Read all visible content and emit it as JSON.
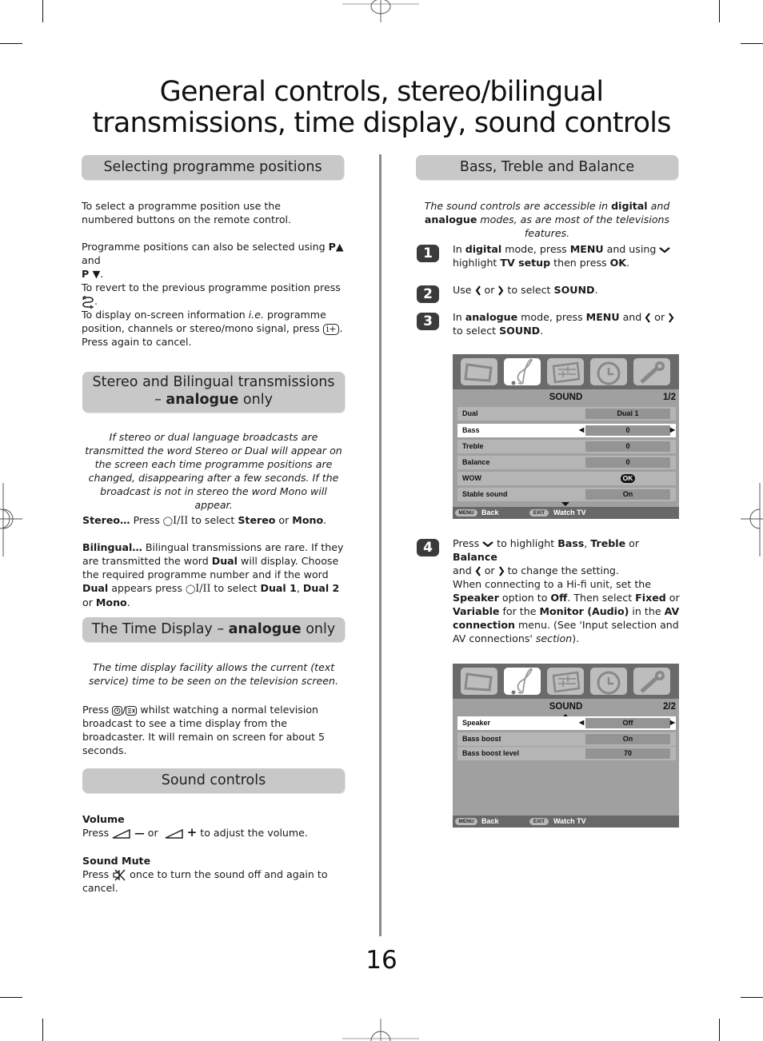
{
  "page": {
    "title_line1": "General controls, stereo/bilingual",
    "title_line2": "transmissions, time display, sound controls",
    "page_number": "16"
  },
  "left": {
    "section1": {
      "heading": "Selecting programme positions",
      "p1": "To select a programme position use the numbered buttons on the remote control.",
      "p2_a": "Programme positions can also be selected using ",
      "p2_b1": "P▲",
      "p2_c": " and ",
      "p2_b2": "P ▼",
      "p2_d": ".",
      "p3_a": "To revert to the previous programme position press ",
      "p3_b": ".",
      "p4_a": "To display on-screen information ",
      "p4_i": "i.e.",
      "p4_b": " programme position, channels or stereo/mono signal, press ",
      "p4_key": "i+",
      "p4_c": ". Press again to cancel."
    },
    "section2": {
      "heading_a": "Stereo and Bilingual transmissions",
      "heading_b1": "– ",
      "heading_bold": "analogue",
      "heading_b2": " only",
      "intro": "If stereo or dual language broadcasts are transmitted the word Stereo or Dual will appear on the screen each time programme positions are changed, disappearing after a few seconds. If the broadcast is not in stereo the word Mono will appear.",
      "stereo_label": "Stereo…",
      "stereo_a": " Press ",
      "stereo_key": "I/II",
      "stereo_b": " to select ",
      "stereo_opt1": "Stereo",
      "stereo_or": " or ",
      "stereo_opt2": "Mono",
      "stereo_end": ".",
      "bi_label": "Bilingual…",
      "bi_a": " Bilingual transmissions are rare. If they are transmitted the word ",
      "bi_dual": "Dual",
      "bi_b": " will display. Choose the required programme number and if the word ",
      "bi_dual2": "Dual",
      "bi_c": " appears press ",
      "bi_key": "I/II",
      "bi_d": " to select ",
      "bi_opt1": "Dual 1",
      "bi_comma": ", ",
      "bi_opt2": "Dual 2",
      "bi_or": " or ",
      "bi_opt3": "Mono",
      "bi_end": "."
    },
    "section3": {
      "heading_a": "The Time Display – ",
      "heading_bold": "analogue",
      "heading_b": " only",
      "intro": "The time display facility allows the current (text service) time to be seen on the television screen.",
      "p_a": "Press ",
      "p_sep": "/",
      "p_b": " whilst watching a normal television broadcast to see a time display from the broadcaster. It will remain on screen for about 5 seconds."
    },
    "section4": {
      "heading": "Sound controls",
      "volume_title": "Volume",
      "volume_a": "Press ",
      "volume_minus": "—",
      "volume_or": " or ",
      "volume_plus": "+",
      "volume_b": " to adjust the volume.",
      "mute_title": "Sound Mute",
      "mute_a": "Press ",
      "mute_b": " once to turn the sound off and again to cancel."
    }
  },
  "right": {
    "heading": "Bass, Treble and Balance",
    "intro_a": "The sound controls are accessible in ",
    "intro_b1": "digital",
    "intro_c": " and ",
    "intro_b2": "analogue",
    "intro_d": " modes, as are most of the televisions features.",
    "steps": [
      {
        "num": "1",
        "a": "In ",
        "b1": "digital",
        "c": " mode, press ",
        "b2": "MENU",
        "d": " and using ",
        "e": " highlight ",
        "b3": "TV setup",
        "f": " then press ",
        "b4": "OK",
        "g": "."
      },
      {
        "num": "2",
        "a": "Use ",
        "or": " or ",
        "c": " to select ",
        "b1": "SOUND",
        "d": "."
      },
      {
        "num": "3",
        "a": "In ",
        "b1": "analogue",
        "c": " mode, press ",
        "b2": "MENU",
        "d": " and ",
        "or": " or ",
        "e": " to select ",
        "b3": "SOUND",
        "f": "."
      },
      {
        "num": "4",
        "a": "Press ",
        "b": " to highlight ",
        "b1": "Bass",
        "comma": ", ",
        "b2": "Treble",
        "or": " or ",
        "b3": "Balance",
        "c": " and ",
        "or2": " or ",
        "d": " to change the setting."
      }
    ],
    "hifi": {
      "a": "When connecting to a Hi-fi unit, set the ",
      "b1": "Speaker",
      "c": " option to ",
      "b2": "Off",
      "d": ". Then select ",
      "b3": "Fixed",
      "or": " or ",
      "b4": "Variable",
      "e": " for the ",
      "b5": "Monitor (Audio)",
      "f": " in the ",
      "b6": "AV connection",
      "g": " menu. (See 'Input selection and AV connections' ",
      "i": "section",
      "h": ")."
    },
    "osd1": {
      "tabs": [
        "tv-icon",
        "music-note-icon",
        "equalizer-icon",
        "clock-icon",
        "wrench-icon"
      ],
      "active_tab": 1,
      "title": "SOUND",
      "page": "1/2",
      "rows": [
        {
          "label": "Dual",
          "value": "Dual 1",
          "selected": false
        },
        {
          "label": "Bass",
          "value": "0",
          "selected": true
        },
        {
          "label": "Treble",
          "value": "0",
          "selected": false
        },
        {
          "label": "Balance",
          "value": "0",
          "selected": false
        },
        {
          "label": "WOW",
          "value": "OK",
          "selected": false
        },
        {
          "label": "Stable sound",
          "value": "On",
          "selected": false
        }
      ],
      "footer": {
        "menu_key": "MENU",
        "menu_label": "Back",
        "exit_key": "EXIT",
        "exit_label": "Watch TV"
      }
    },
    "osd2": {
      "tabs": [
        "tv-icon",
        "music-note-icon",
        "equalizer-icon",
        "clock-icon",
        "wrench-icon"
      ],
      "active_tab": 1,
      "title": "SOUND",
      "page": "2/2",
      "rows": [
        {
          "label": "Speaker",
          "value": "Off",
          "selected": true
        },
        {
          "label": "Bass boost",
          "value": "On",
          "selected": false
        },
        {
          "label": "Bass boost level",
          "value": "70",
          "selected": false
        }
      ],
      "footer": {
        "menu_key": "MENU",
        "menu_label": "Back",
        "exit_key": "EXIT",
        "exit_label": "Watch TV"
      }
    }
  }
}
